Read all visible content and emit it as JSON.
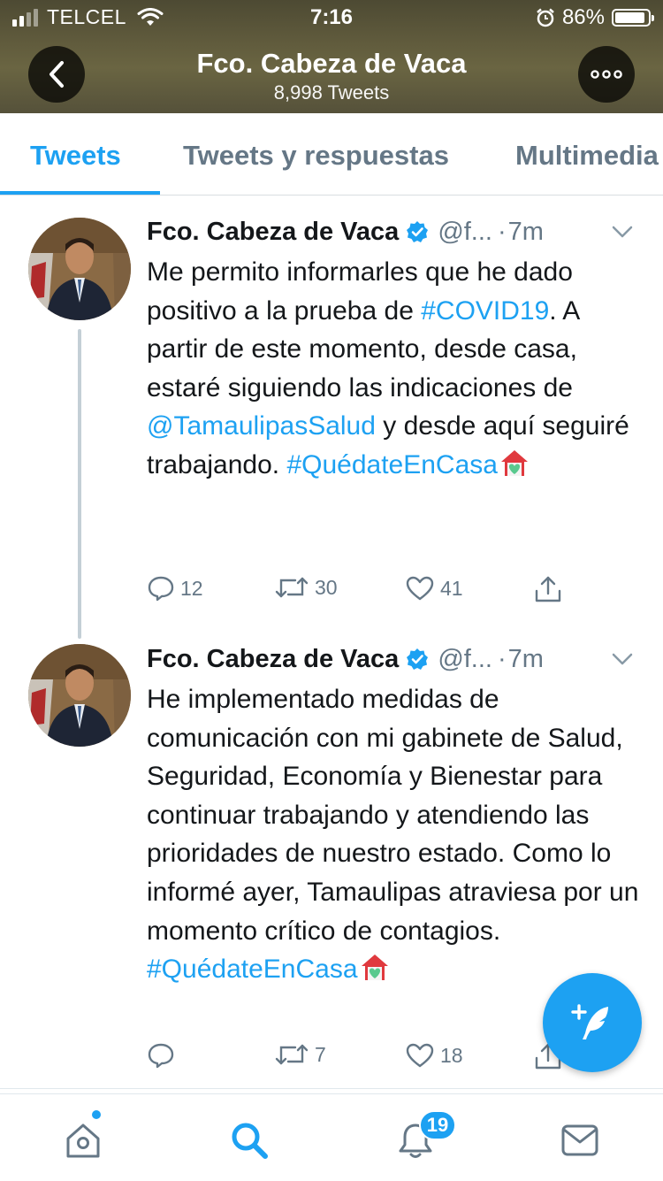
{
  "status_bar": {
    "carrier": "TELCEL",
    "time": "7:16",
    "battery_percent": "86%",
    "battery_level": 0.86,
    "signal_bars": 2
  },
  "header": {
    "name": "Fco. Cabeza de Vaca",
    "tweet_count": "8,998 Tweets",
    "back_icon": "chevron-left-icon",
    "more_icon": "ellipsis-icon"
  },
  "tabs": [
    {
      "label": "Tweets",
      "active": true
    },
    {
      "label": "Tweets y respuestas",
      "active": false
    },
    {
      "label": "Multimedia",
      "active": false
    }
  ],
  "tweets": [
    {
      "name": "Fco. Cabeza de Vaca",
      "handle": "@f...",
      "separator": "·",
      "time": "7m",
      "text_1": "Me permito informarles que he dado positivo a la prueba de ",
      "hashtag_1": "#COVID19",
      "text_2": ". A partir de este momento, desde casa, estaré siguiendo las indicaciones de ",
      "mention_1": "@TamaulipasSalud",
      "text_3": " y desde aquí seguiré trabajando. ",
      "hashtag_2": "#QuédateEnCasa",
      "replies": "12",
      "retweets": "30",
      "likes": "41"
    },
    {
      "name": "Fco. Cabeza de Vaca",
      "handle": "@f...",
      "separator": "·",
      "time": "7m",
      "text_1": "He implementado medidas de comunicación con mi gabinete de Salud, Seguridad, Economía y Bienestar para continuar trabajando y atendiendo las prioridades de nuestro estado. Como lo informé ayer, Tamaulipas atraviesa por un momento crítico de contagios. ",
      "hashtag_1": "#QuédateEnCasa",
      "replies": "",
      "retweets": "7",
      "likes": "18"
    }
  ],
  "bottom_nav": {
    "notifications_badge": "19",
    "items": [
      "home-icon",
      "search-icon",
      "bell-icon",
      "mail-icon"
    ]
  },
  "colors": {
    "accent": "#1da1f2",
    "muted": "#657786",
    "text": "#14171a",
    "house_emoji": "#e0393e"
  }
}
